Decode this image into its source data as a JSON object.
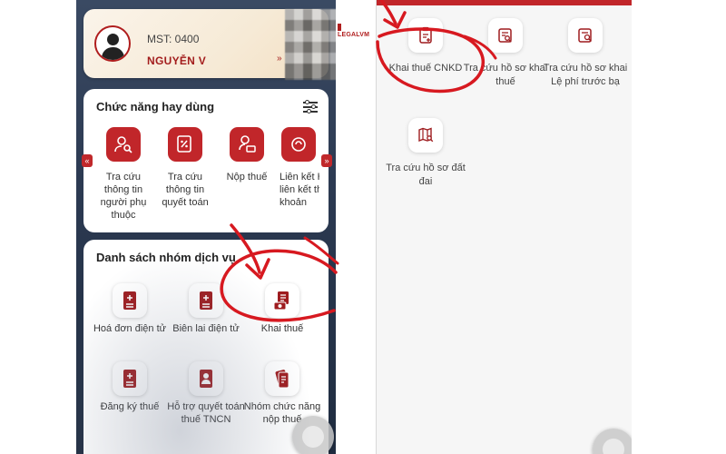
{
  "left_screen": {
    "profile": {
      "mst_label": "MST: 0400",
      "name": "NGUYỄN V",
      "name_suffix": "»"
    },
    "frequent": {
      "title": "Chức năng hay dùng",
      "items": [
        {
          "label": "Tra cứu thông tin người phụ thuộc",
          "icon": "person-search-icon"
        },
        {
          "label": "Tra cứu thông tin quyết toán",
          "icon": "percent-document-icon"
        },
        {
          "label": "Nộp thuế",
          "icon": "person-money-icon"
        },
        {
          "label": "Liên kết Hủy liên kết thẻ khoản",
          "icon": "link-icon"
        }
      ],
      "left_arrow": "«",
      "right_arrow": "»"
    },
    "services": {
      "title": "Danh sách nhóm dịch vụ",
      "items": [
        {
          "label": "Hoá đơn điện tử",
          "icon": "invoice-icon"
        },
        {
          "label": "Biên lai điện tử",
          "icon": "receipt-icon"
        },
        {
          "label": "Khai thuế",
          "icon": "tax-declaration-icon"
        },
        {
          "label": "Đăng ký thuế",
          "icon": "tax-register-icon"
        },
        {
          "label": "Hỗ trợ quyết toán thuế TNCN",
          "icon": "personal-tax-icon"
        },
        {
          "label": "Nhóm chức năng nộp thuế",
          "icon": "tax-payment-group-icon"
        }
      ]
    }
  },
  "logo": {
    "text_a": "LEGAL",
    "text_b": "VM"
  },
  "right_screen": {
    "items": [
      {
        "label": "Khai thuế CNKD",
        "icon": "clipboard-plus-icon"
      },
      {
        "label": "Tra cứu hồ sơ khai thuế",
        "icon": "document-search-icon"
      },
      {
        "label": "Tra cứu hồ sơ khai Lệ phí trước bạ",
        "icon": "car-search-icon"
      },
      {
        "label": "Tra cứu hồ sơ đất đai",
        "icon": "land-map-search-icon"
      }
    ]
  },
  "colors": {
    "brand_red": "#c1262a",
    "annotation_red": "#d71920",
    "phone_dark": "#2c3a52"
  }
}
